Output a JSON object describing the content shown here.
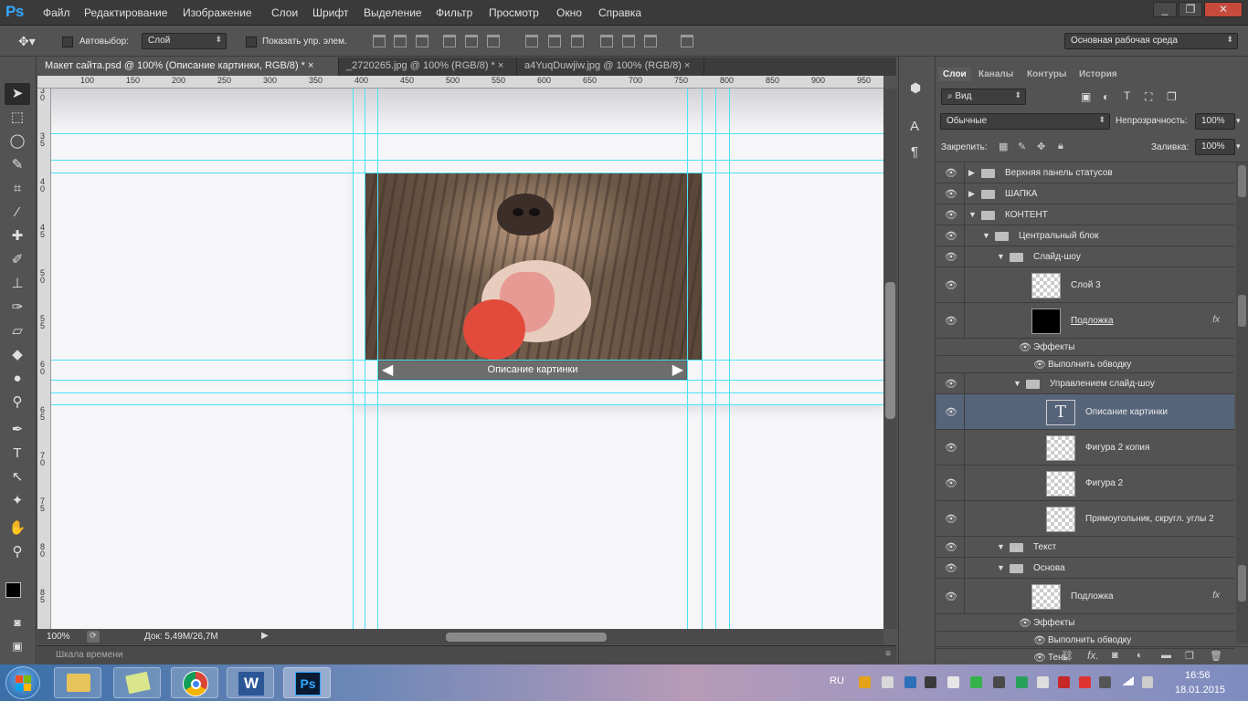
{
  "app": {
    "logo": "Ps"
  },
  "menu": [
    "Файл",
    "Редактирование",
    "Изображение",
    "Слои",
    "Шрифт",
    "Выделение",
    "Фильтр",
    "Просмотр",
    "Окно",
    "Справка"
  ],
  "window_controls": [
    "_",
    "❐",
    "✕"
  ],
  "options": {
    "autoselect_label": "Автовыбор:",
    "autoselect_value": "Слой",
    "show_controls_label": "Показать упр. элем.",
    "workspace": "Основная рабочая среда"
  },
  "tabs": [
    {
      "label": "Макет сайта.psd @ 100% (Описание картинки, RGB/8) *",
      "close": "×"
    },
    {
      "label": "_2720265.jpg @ 100% (RGB/8) *",
      "close": "×"
    },
    {
      "label": "a4YuqDuwjiw.jpg @ 100% (RGB/8)",
      "close": "×"
    }
  ],
  "ruler_h": [
    "100",
    "150",
    "200",
    "250",
    "300",
    "350",
    "400",
    "450",
    "500",
    "550",
    "600",
    "650",
    "700",
    "750",
    "800",
    "850",
    "900",
    "950"
  ],
  "ruler_v": [
    "3 0",
    "3 5",
    "4 0",
    "4 5",
    "5 0",
    "5 5",
    "6 0",
    "6 5",
    "7 0",
    "7 5",
    "8 0",
    "8 5"
  ],
  "canvas": {
    "caption": "Описание картинки"
  },
  "status": {
    "zoom": "100%",
    "doc": "Док: 5,49M/26,7M"
  },
  "timeline_label": "Шкала времени",
  "panel": {
    "tabs": [
      "Слои",
      "Каналы",
      "Контуры",
      "История"
    ],
    "filter": "Вид",
    "blend": "Обычные",
    "opacity_label": "Непрозрачность:",
    "opacity": "100%",
    "lock_label": "Закрепить:",
    "fill_label": "Заливка:",
    "fill": "100%"
  },
  "layers": [
    {
      "name": "Верхняя панель статусов",
      "kind": "folder",
      "indent": 0,
      "open": false
    },
    {
      "name": "ШАПКА",
      "kind": "folder",
      "indent": 0,
      "open": false
    },
    {
      "name": "КОНТЕНТ",
      "kind": "folder",
      "indent": 0,
      "open": true
    },
    {
      "name": "Центральный блок",
      "kind": "folder",
      "indent": 1,
      "open": true
    },
    {
      "name": "Слайд-шоу",
      "kind": "folder",
      "indent": 2,
      "open": true
    },
    {
      "name": "Слой 3",
      "kind": "layer",
      "indent": 3
    },
    {
      "name": "Подложка",
      "kind": "layer-black",
      "indent": 3
    },
    {
      "name": "Эффекты",
      "kind": "fx",
      "indent": 4
    },
    {
      "name": "Выполнить обводку",
      "kind": "fx",
      "indent": 5
    },
    {
      "name": "Управлением слайд-шоу",
      "kind": "folder",
      "indent": 3,
      "open": true
    },
    {
      "name": "Описание картинки",
      "kind": "text",
      "indent": 4
    },
    {
      "name": "Фигура 2 копия",
      "kind": "layer",
      "indent": 4
    },
    {
      "name": "Фигура 2",
      "kind": "layer",
      "indent": 4
    },
    {
      "name": "Прямоугольник, скругл. углы 2",
      "kind": "layer",
      "indent": 4
    },
    {
      "name": "Текст",
      "kind": "folder",
      "indent": 2,
      "open": true
    },
    {
      "name": "Основа",
      "kind": "folder",
      "indent": 2,
      "open": true
    },
    {
      "name": "Подложка",
      "kind": "layer",
      "indent": 3
    },
    {
      "name": "Эффекты",
      "kind": "fx",
      "indent": 4
    },
    {
      "name": "Выполнить обводку",
      "kind": "fx",
      "indent": 5
    },
    {
      "name": "Тень",
      "kind": "fx",
      "indent": 5
    }
  ],
  "taskbar": {
    "lang": "RU",
    "time": "16:56",
    "date": "18.01.2015"
  }
}
